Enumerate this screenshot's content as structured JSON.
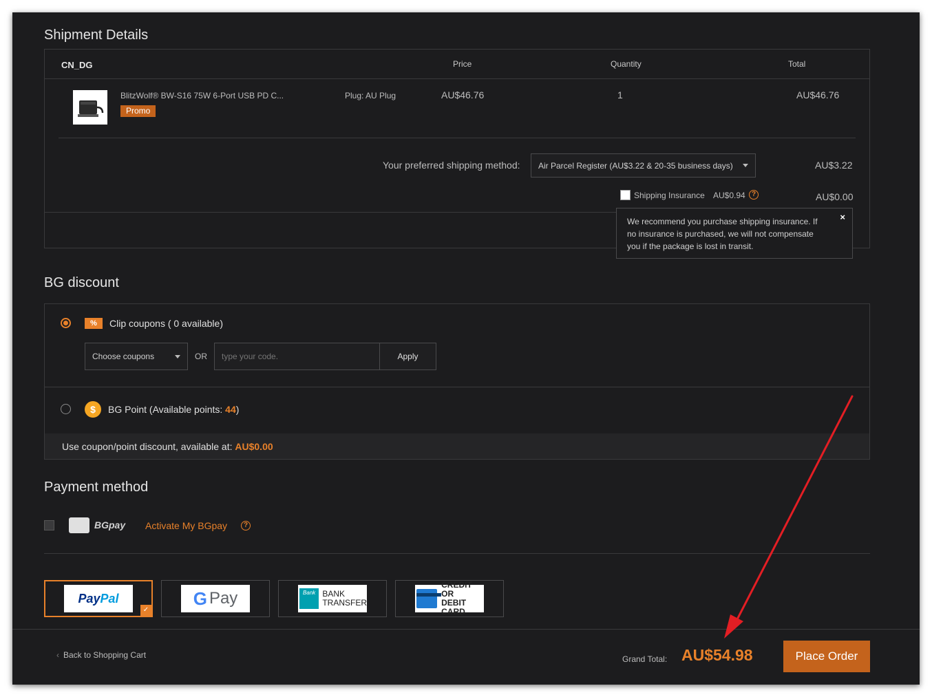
{
  "shipment": {
    "title": "Shipment Details",
    "warehouse": "CN_DG",
    "columns": {
      "price": "Price",
      "quantity": "Quantity",
      "total": "Total"
    },
    "item": {
      "name": "BlitzWolf® BW-S16 75W 6-Port USB PD C...",
      "badge": "Promo",
      "option": "Plug: AU Plug",
      "price": "AU$46.76",
      "quantity": "1",
      "total": "AU$46.76"
    },
    "shipping_label": "Your preferred shipping method:",
    "shipping_method": "Air Parcel Register (AU$3.22 & 20-35 business days)",
    "shipping_cost": "AU$3.22",
    "insurance_label": "Shipping Insurance",
    "insurance_price": "AU$0.94",
    "insurance_total": "AU$0.00",
    "insurance_help_icon": "question-circle-icon",
    "tooltip": "We recommend you purchase shipping insurance. If no insurance is purchased, we will not compensate you if the package is lost in transit.",
    "tooltip_close": "×"
  },
  "discount": {
    "title": "BG discount",
    "coupons_label": "Clip coupons ( 0 available)",
    "choose_coupons": "Choose coupons",
    "or": "OR",
    "code_placeholder": "type your code.",
    "apply": "Apply",
    "points_label": "BG Point (Available points:",
    "points_value": "44",
    "points_close": ")",
    "coin_symbol": "$",
    "available_label": "Use coupon/point discount, available at:",
    "available_value": "AU$0.00"
  },
  "payment": {
    "title": "Payment method",
    "bgpay_label": "BGpay",
    "activate_link": "Activate My BGpay",
    "methods": [
      {
        "name": "paypal",
        "label_a": "Pay",
        "label_b": "Pal",
        "selected": true
      },
      {
        "name": "gpay",
        "label_g": "G",
        "label_pay": "Pay"
      },
      {
        "name": "bank-transfer",
        "bank_word": "Bank",
        "line1": "BANK",
        "line2": "TRANSFER"
      },
      {
        "name": "card",
        "line1": "CREDIT OR",
        "line2": "DEBIT CARD"
      }
    ]
  },
  "footer": {
    "back_link": "Back to Shopping Cart",
    "grand_total_label": "Grand Total:",
    "grand_total": "AU$54.98",
    "place_order": "Place Order"
  },
  "colors": {
    "accent": "#e8812a",
    "button": "#c4631c",
    "panel": "#1c1c1e",
    "arrow": "#e31e24"
  }
}
